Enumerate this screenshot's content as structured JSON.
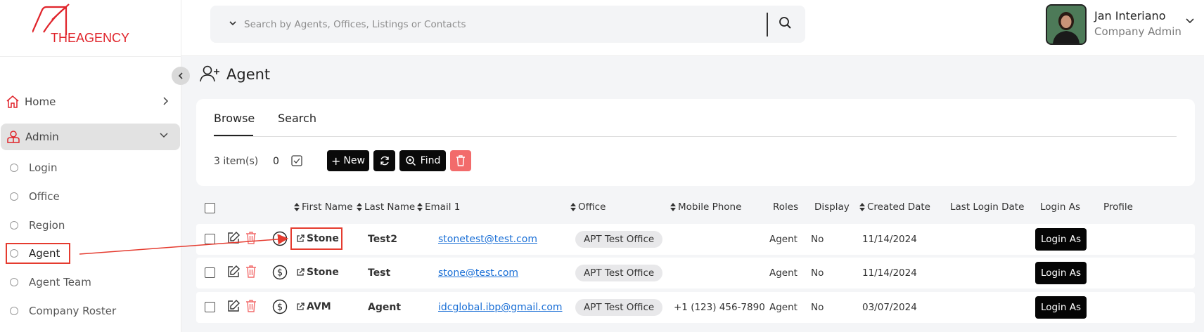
{
  "brand": {
    "logo_text": "THEAGENCY",
    "accent": "#e0242b"
  },
  "sidebar": {
    "home_label": "Home",
    "admin_label": "Admin",
    "sub_items": [
      "Login",
      "Office",
      "Region",
      "Agent",
      "Agent Team",
      "Company Roster"
    ]
  },
  "search": {
    "placeholder": "Search by Agents, Offices, Listings or Contacts"
  },
  "user": {
    "name": "Jan Interiano",
    "role": "Company Admin"
  },
  "page": {
    "title": "Agent"
  },
  "tabs": [
    "Browse",
    "Search"
  ],
  "toolbar": {
    "count_label": "3 item(s)",
    "selected_count": "0",
    "new_label": "New",
    "find_label": "Find"
  },
  "table": {
    "headers": [
      "First Name",
      "Last Name",
      "Email 1",
      "Office",
      "Mobile Phone",
      "Roles",
      "Display",
      "Created Date",
      "Last Login Date",
      "Login As",
      "Profile"
    ],
    "rows": [
      {
        "first_name": "Stone",
        "last_name": "Test2",
        "email": "stonetest@test.com",
        "office": "APT Test Office",
        "mobile": "",
        "role": "Agent",
        "display": "No",
        "created": "11/14/2024",
        "login_label": "Login As"
      },
      {
        "first_name": "Stone",
        "last_name": "Test",
        "email": "stone@test.com",
        "office": "APT Test Office",
        "mobile": "",
        "role": "Agent",
        "display": "No",
        "created": "11/14/2024",
        "login_label": "Login As"
      },
      {
        "first_name": "AVM",
        "last_name": "Agent",
        "email": "idcglobal.ibp@gmail.com",
        "office": "APT Test Office",
        "mobile": "+1 (123) 456-7890",
        "role": "Agent",
        "display": "No",
        "created": "03/07/2024",
        "login_label": "Login As"
      }
    ]
  },
  "annotation_color": "#e53b2f"
}
